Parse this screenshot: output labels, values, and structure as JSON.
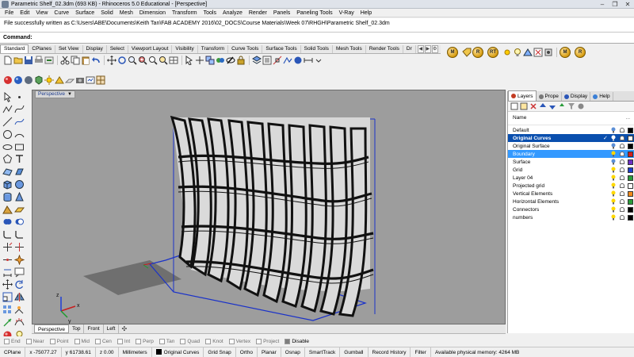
{
  "window": {
    "title": "Parametric Shelf_02.3dm (693 KB) - Rhinoceros 5.0 Educational - [Perspective]",
    "buttons": [
      "‒",
      "❐",
      "✕"
    ]
  },
  "menu": [
    "File",
    "Edit",
    "View",
    "Curve",
    "Surface",
    "Solid",
    "Mesh",
    "Dimension",
    "Transform",
    "Tools",
    "Analyze",
    "Render",
    "Panels",
    "Paneling Tools",
    "V-Ray",
    "Help"
  ],
  "history_text": "File successfully written as C:\\Users\\ABE\\Documents\\Keith Tan\\FAB ACADEMY 2016\\02_DOCS\\Course Materials\\Week 07\\RHGH\\Parametric Shelf_02.3dm",
  "command": {
    "label": "Command:",
    "value": ""
  },
  "tool_tabs": [
    "Standard",
    "CPlanes",
    "Set View",
    "Display",
    "Select",
    "Viewport Layout",
    "Visibility",
    "Transform",
    "Curve Tools",
    "Surface Tools",
    "Solid Tools",
    "Mesh Tools",
    "Render Tools",
    "Dr"
  ],
  "render_buttons": [
    "M",
    "R",
    "RT",
    "M",
    "R"
  ],
  "viewport": {
    "label": "Perspective",
    "tabs": [
      "Perspective",
      "Top",
      "Front",
      "Left"
    ],
    "axis_labels": {
      "x": "x",
      "y": "y",
      "z": "z"
    }
  },
  "osnaps": [
    {
      "label": "End",
      "active": false
    },
    {
      "label": "Near",
      "active": false
    },
    {
      "label": "Point",
      "active": false
    },
    {
      "label": "Mid",
      "active": false
    },
    {
      "label": "Cen",
      "active": false
    },
    {
      "label": "Int",
      "active": false
    },
    {
      "label": "Perp",
      "active": false
    },
    {
      "label": "Tan",
      "active": false
    },
    {
      "label": "Quad",
      "active": false
    },
    {
      "label": "Knot",
      "active": false
    },
    {
      "label": "Vertex",
      "active": false
    },
    {
      "label": "Project",
      "active": false
    },
    {
      "label": "Disable",
      "active": true
    }
  ],
  "status": {
    "cplane": "CPlane",
    "x": "x -75077.27",
    "y": "y 61738.61",
    "z": "z 0.00",
    "units": "Millimeters",
    "current_layer": "Original Curves",
    "toggles": [
      "Grid Snap",
      "Ortho",
      "Planar",
      "Osnap",
      "SmartTrack",
      "Gumball",
      "Record History",
      "Filter"
    ],
    "memory": "Available physical memory: 4264 MB"
  },
  "panel": {
    "tabs": [
      "Layers",
      "Prope",
      "Display",
      "Help"
    ],
    "column_header": "Name",
    "layers": [
      {
        "name": "Default",
        "color": "#000000",
        "bulb_color": "#5b8fd6",
        "check": false
      },
      {
        "name": "Original Curves",
        "color": "#ffffff",
        "bulb_color": "#ffffff",
        "check": true
      },
      {
        "name": "Original Surface",
        "color": "#000000",
        "bulb_color": "#5b8fd6",
        "check": false
      },
      {
        "name": "Boundary",
        "color": "#d11d1d",
        "bulb_color": "#ffd800",
        "check": false
      },
      {
        "name": "Surface",
        "color": "#6b2fc4",
        "bulb_color": "#5b8fd6",
        "check": false
      },
      {
        "name": "Grid",
        "color": "#1c3fce",
        "bulb_color": "#ffd800",
        "check": false
      },
      {
        "name": "Layer 04",
        "color": "#2a9c3a",
        "bulb_color": "#ffd800",
        "check": false
      },
      {
        "name": "Projected grid",
        "color": "#ffffff",
        "bulb_color": "#ffd800",
        "check": false
      },
      {
        "name": "Vertical Elements",
        "color": "#f28a1b",
        "bulb_color": "#ffd800",
        "check": false
      },
      {
        "name": "Horizontal Elements",
        "color": "#2a9c3a",
        "bulb_color": "#ffd800",
        "check": false
      },
      {
        "name": "Connectors",
        "color": "#000000",
        "bulb_color": "#ffd800",
        "check": false
      },
      {
        "name": "numbers",
        "color": "#000000",
        "bulb_color": "#ffd800",
        "check": false
      }
    ]
  }
}
